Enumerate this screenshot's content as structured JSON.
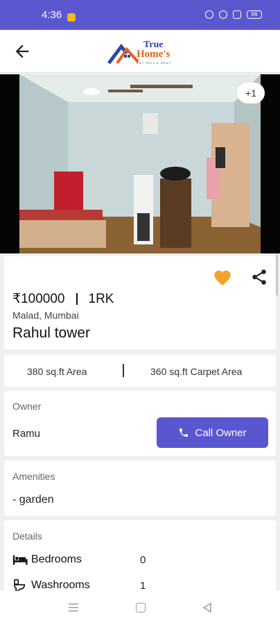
{
  "status_bar": {
    "time": "4:36",
    "battery": "66"
  },
  "header": {
    "logo_line1": "True",
    "logo_line2": "Home's",
    "logo_tagline": "BUY SELL & RENT"
  },
  "gallery": {
    "more_count": "+1"
  },
  "listing": {
    "price": "₹100000",
    "type": "1RK",
    "locality": "Malad, Mumbai",
    "title": "Rahul tower",
    "area": "380 sq.ft Area",
    "carpet_area": "360 sq.ft Carpet Area"
  },
  "owner": {
    "heading": "Owner",
    "name": "Ramu",
    "call_label": "Call Owner"
  },
  "amenities": {
    "heading": "Amenities",
    "items": [
      "- garden"
    ]
  },
  "details": {
    "heading": "Details",
    "rows": [
      {
        "label": "Bedrooms",
        "value": "0",
        "icon": "bed-icon"
      },
      {
        "label": "Washrooms",
        "value": "1",
        "icon": "toilet-icon"
      }
    ]
  },
  "colors": {
    "primary": "#5a56d0",
    "status_bar": "#5b57cf",
    "favorite": "#f4a22a"
  }
}
